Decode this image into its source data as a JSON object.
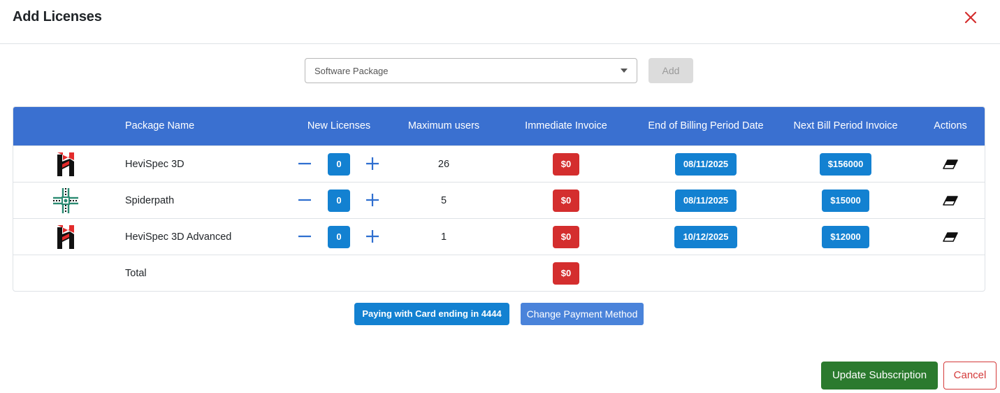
{
  "header": {
    "title": "Add Licenses",
    "close_icon": "close-icon"
  },
  "selector": {
    "placeholder": "Software Package",
    "add_label": "Add"
  },
  "table": {
    "columns": [
      "Package Name",
      "New Licenses",
      "Maximum users",
      "Immediate Invoice",
      "End of Billing Period Date",
      "Next Bill Period Invoice",
      "Actions"
    ],
    "rows": [
      {
        "logo": "hevispec-logo",
        "name": "HeviSpec 3D",
        "new_licenses": "0",
        "max_users": "26",
        "immediate_invoice": "$0",
        "end_date": "08/11/2025",
        "next_invoice": "$156000",
        "action_icon": "eraser-icon"
      },
      {
        "logo": "spiderpath-logo",
        "name": "Spiderpath",
        "new_licenses": "0",
        "max_users": "5",
        "immediate_invoice": "$0",
        "end_date": "08/11/2025",
        "next_invoice": "$15000",
        "action_icon": "eraser-icon"
      },
      {
        "logo": "hevispec-logo",
        "name": "HeviSpec 3D Advanced",
        "new_licenses": "0",
        "max_users": "1",
        "immediate_invoice": "$0",
        "end_date": "10/12/2025",
        "next_invoice": "$12000",
        "action_icon": "eraser-icon"
      }
    ],
    "total": {
      "label": "Total",
      "immediate_invoice": "$0"
    }
  },
  "payment": {
    "card_label": "Paying with Card ending in 4444",
    "change_label": "Change Payment Method"
  },
  "footer": {
    "update_label": "Update Subscription",
    "cancel_label": "Cancel"
  },
  "colors": {
    "header_bg": "#3a70d0",
    "primary": "#1381d1",
    "danger": "#d42e2e",
    "success": "#2b7a2e"
  }
}
